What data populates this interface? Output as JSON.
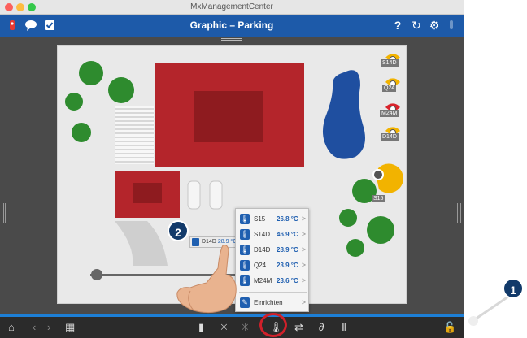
{
  "window": {
    "title": "MxManagementCenter"
  },
  "toolbar": {
    "title": "Graphic – Parking",
    "help": "?",
    "refresh": "↻",
    "settings": "⚙"
  },
  "sensors_right": [
    {
      "label": "S14D"
    },
    {
      "label": "Q24"
    },
    {
      "label": "M24M"
    },
    {
      "label": "D14D"
    }
  ],
  "sensor_s15": {
    "label": "S15"
  },
  "tooltip": {
    "label": "D14D",
    "value": "28.9 °C"
  },
  "popup": {
    "items": [
      {
        "name": "S15",
        "value": "26.8 °C",
        "arrow": ">"
      },
      {
        "name": "S14D",
        "value": "46.9 °C",
        "arrow": ">"
      },
      {
        "name": "D14D",
        "value": "28.9 °C",
        "arrow": ">"
      },
      {
        "name": "Q24",
        "value": "23.9 °C",
        "arrow": ">"
      },
      {
        "name": "M24M",
        "value": "23.6 °C",
        "arrow": ">"
      }
    ],
    "setup": {
      "name": "Einrichten",
      "arrow": ">"
    }
  },
  "badges": {
    "one": "1",
    "two": "2"
  },
  "colors": {
    "accent": "#1d5aa9",
    "building": "#b4252b",
    "tree": "#2e8b2e",
    "water": "#1f4fa0",
    "highlight": "#d1202a"
  }
}
